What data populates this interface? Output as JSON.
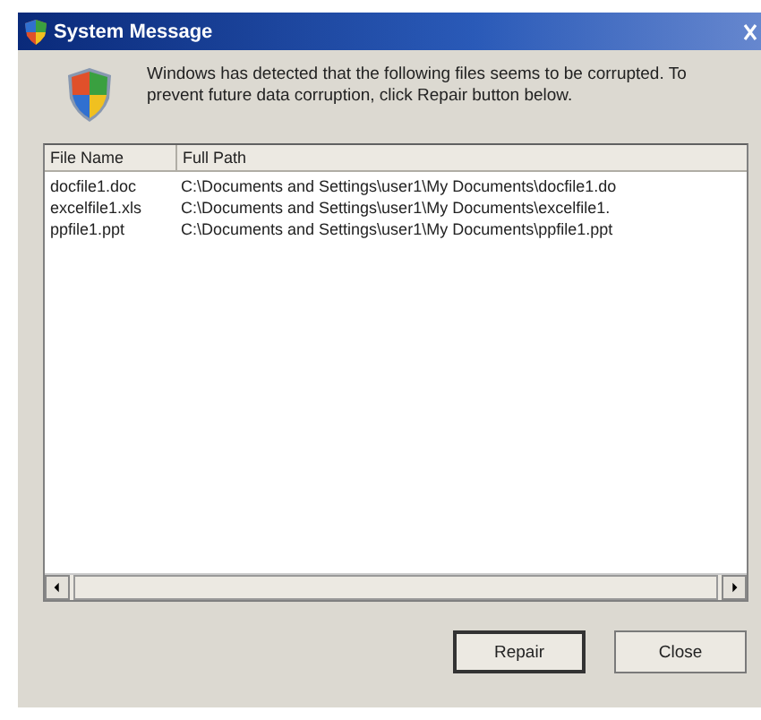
{
  "window": {
    "title": "System Message"
  },
  "message": "Windows has detected that the following files seems to be corrupted. To prevent future data corruption, click Repair button below.",
  "table": {
    "columns": [
      "File Name",
      "Full Path"
    ],
    "rows": [
      {
        "name": "docfile1.doc",
        "path": "C:\\Documents and Settings\\user1\\My Documents\\docfile1.do"
      },
      {
        "name": "excelfile1.xls",
        "path": "C:\\Documents and Settings\\user1\\My Documents\\excelfile1."
      },
      {
        "name": "ppfile1.ppt",
        "path": "C:\\Documents and Settings\\user1\\My Documents\\ppfile1.ppt"
      }
    ]
  },
  "buttons": [
    "Repair",
    "Close"
  ]
}
